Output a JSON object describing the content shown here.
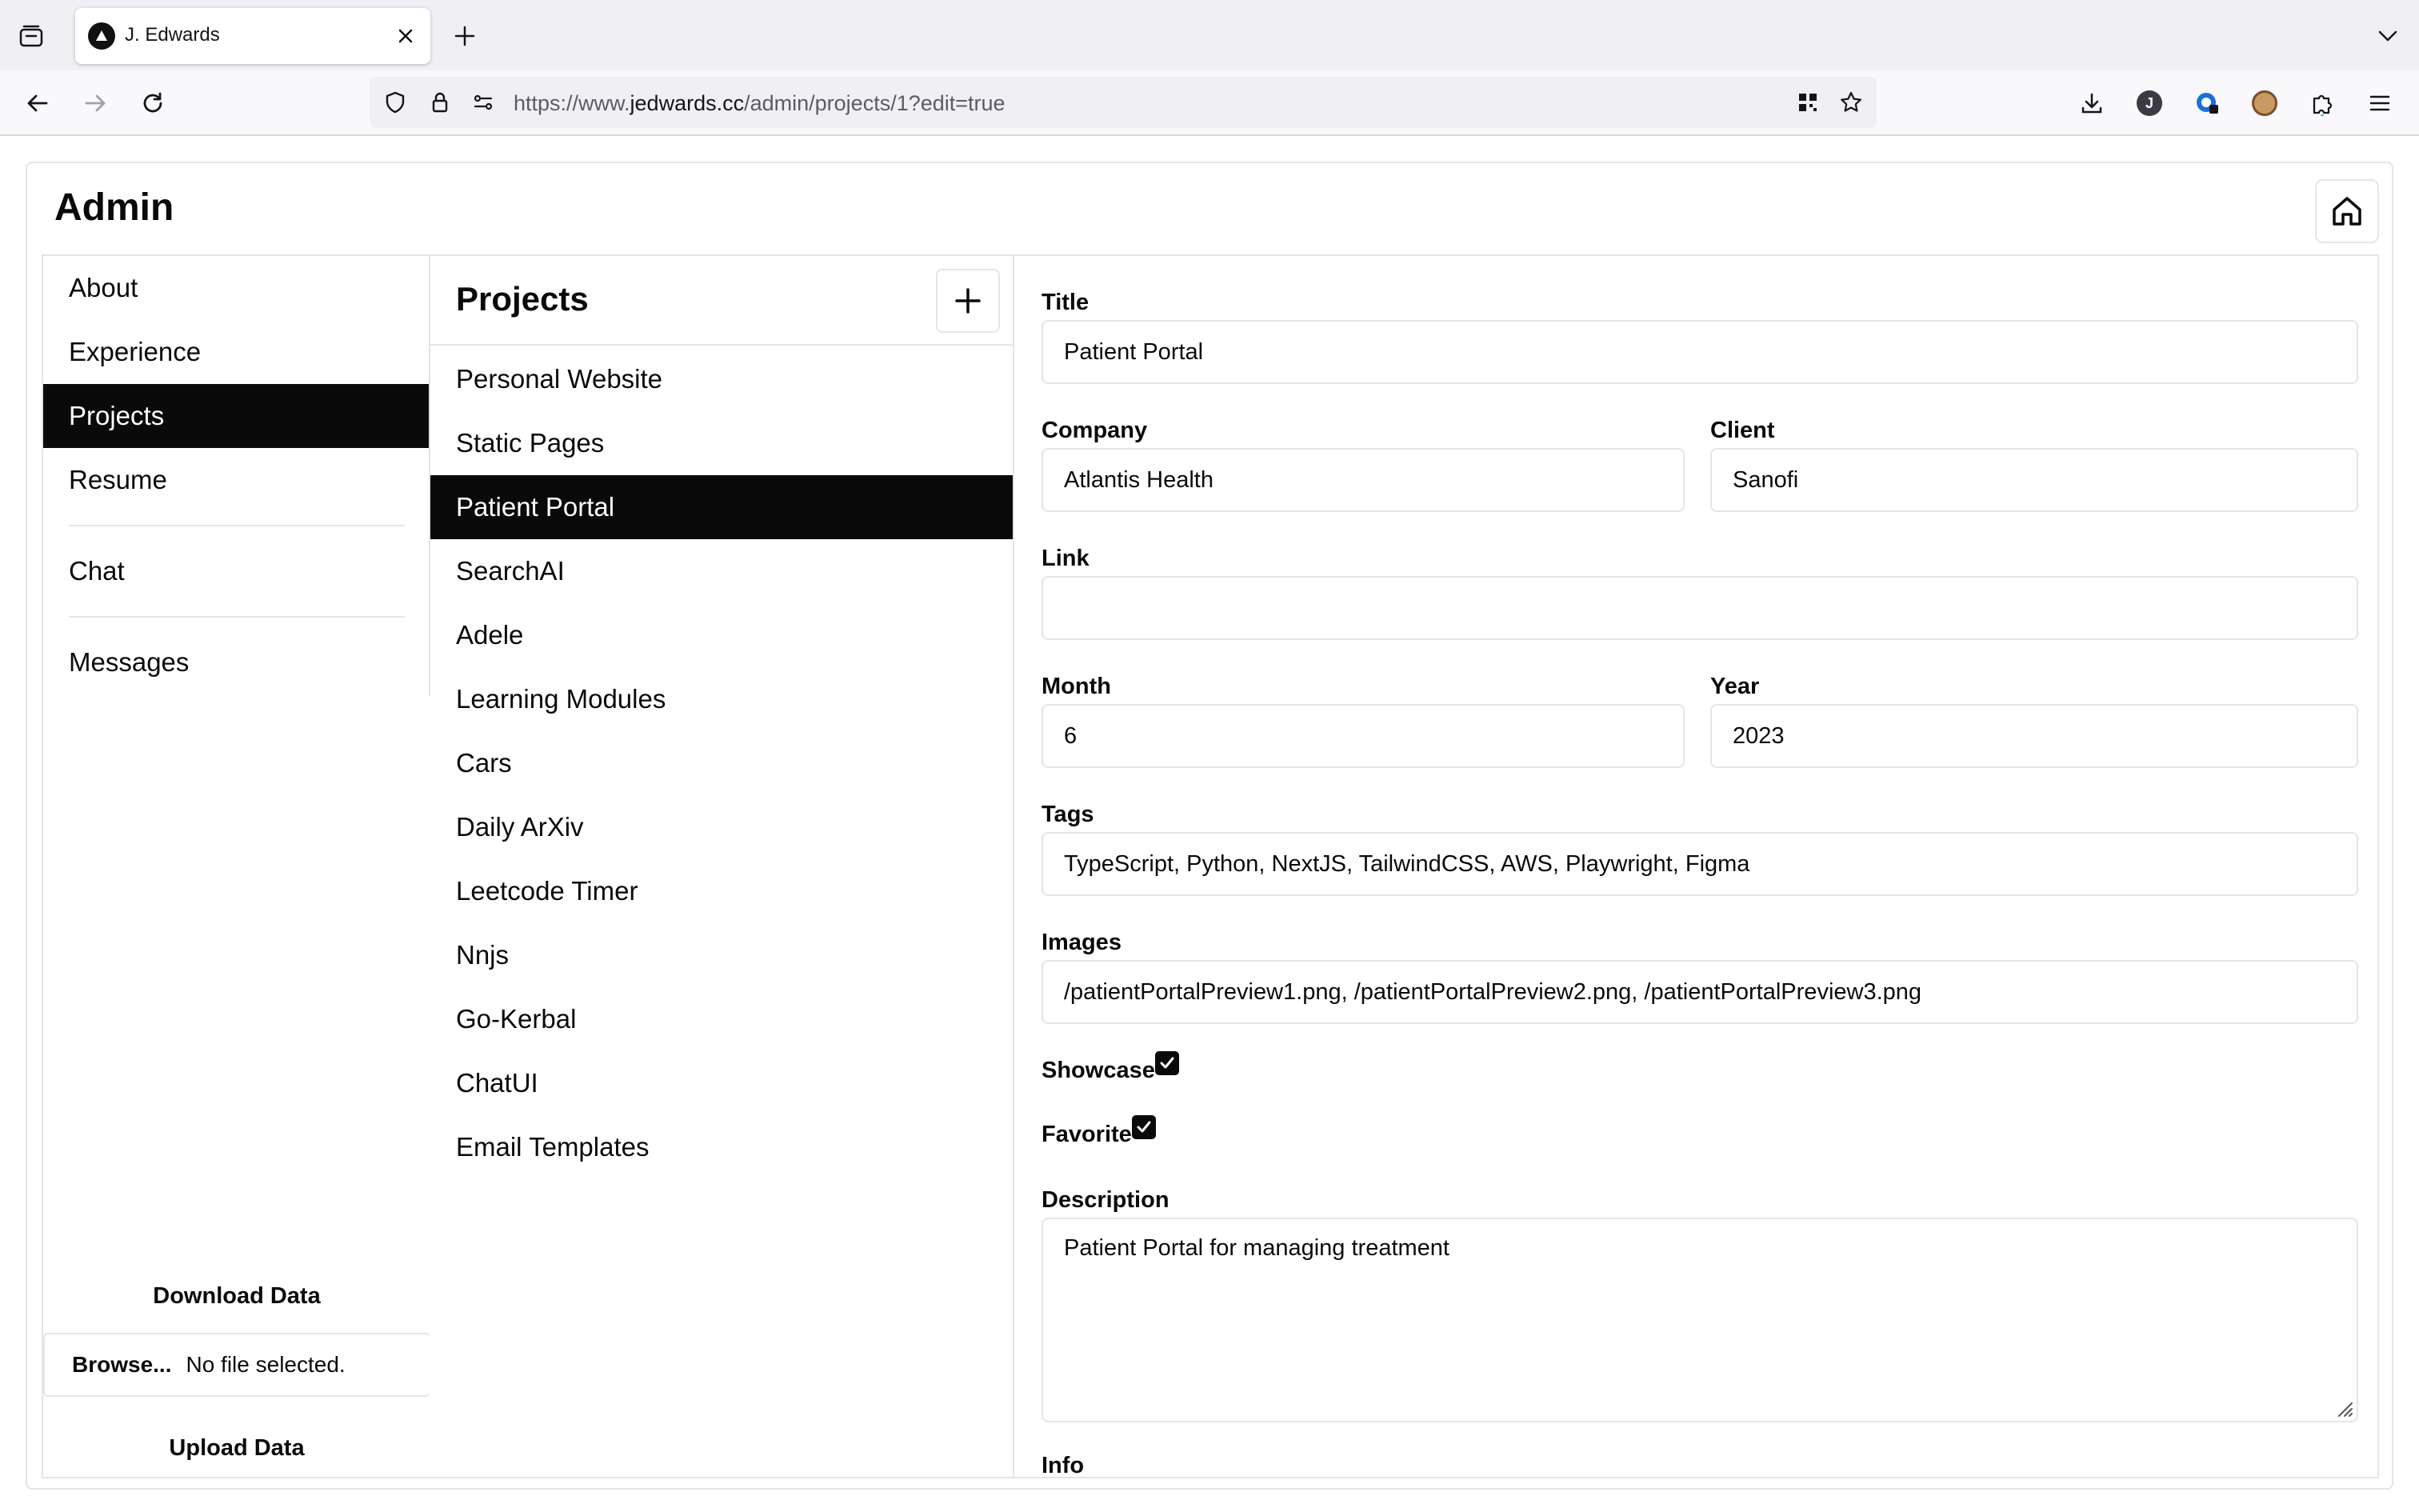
{
  "browser": {
    "tab_title": "J. Edwards",
    "url_prefix": "https://www.",
    "url_host": "jedwards.cc",
    "url_path": "/admin/projects/1?edit=true",
    "profile_initial": "J"
  },
  "page": {
    "title": "Admin"
  },
  "sidebar": {
    "items": [
      {
        "label": "About"
      },
      {
        "label": "Experience"
      },
      {
        "label": "Projects"
      },
      {
        "label": "Resume"
      },
      {
        "label": "Chat"
      },
      {
        "label": "Messages"
      }
    ],
    "active": "Projects",
    "download_label": "Download Data",
    "browse_label": "Browse...",
    "file_status": "No file selected.",
    "upload_label": "Upload Data"
  },
  "projects": {
    "title": "Projects",
    "items": [
      {
        "label": "Personal Website"
      },
      {
        "label": "Static Pages"
      },
      {
        "label": "Patient Portal"
      },
      {
        "label": "SearchAI"
      },
      {
        "label": "Adele"
      },
      {
        "label": "Learning Modules"
      },
      {
        "label": "Cars"
      },
      {
        "label": "Daily ArXiv"
      },
      {
        "label": "Leetcode Timer"
      },
      {
        "label": "Nnjs"
      },
      {
        "label": "Go-Kerbal"
      },
      {
        "label": "ChatUI"
      },
      {
        "label": "Email Templates"
      }
    ],
    "active": "Patient Portal"
  },
  "form": {
    "title_label": "Title",
    "title_value": "Patient Portal",
    "company_label": "Company",
    "company_value": "Atlantis Health",
    "client_label": "Client",
    "client_value": "Sanofi",
    "link_label": "Link",
    "link_value": "",
    "month_label": "Month",
    "month_value": "6",
    "year_label": "Year",
    "year_value": "2023",
    "tags_label": "Tags",
    "tags_value": "TypeScript, Python, NextJS, TailwindCSS, AWS, Playwright, Figma",
    "images_label": "Images",
    "images_value": "/patientPortalPreview1.png, /patientPortalPreview2.png, /patientPortalPreview3.png",
    "showcase_label": "Showcase",
    "showcase_checked": true,
    "favorite_label": "Favorite",
    "favorite_checked": true,
    "description_label": "Description",
    "description_value": "Patient Portal for managing treatment",
    "info_label": "Info"
  }
}
